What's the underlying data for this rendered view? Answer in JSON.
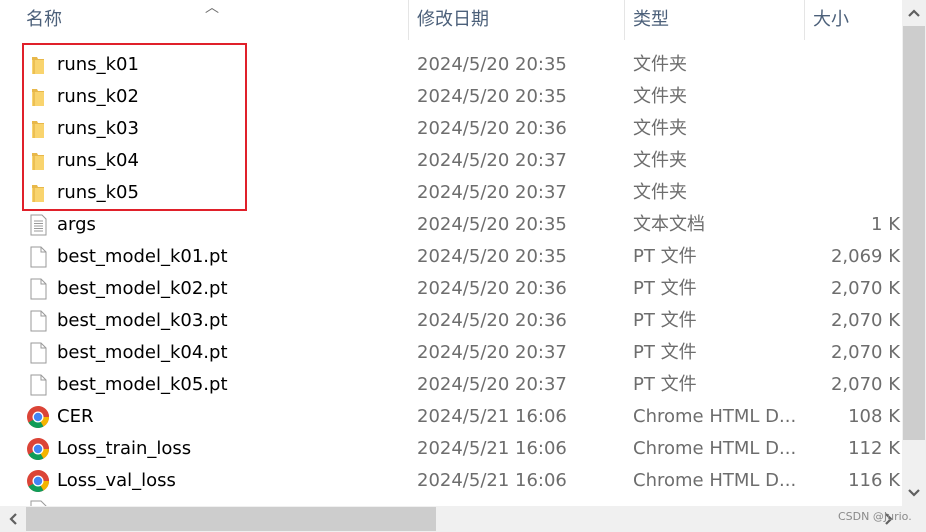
{
  "columns": {
    "name": "名称",
    "date": "修改日期",
    "type": "类型",
    "size": "大小"
  },
  "sort": {
    "column": "name",
    "direction": "ascending"
  },
  "highlight_color": "#e0202a",
  "files": [
    {
      "icon": "folder-icon",
      "name": "runs_k01",
      "date": "2024/5/20 20:35",
      "type": "文件夹",
      "size": ""
    },
    {
      "icon": "folder-icon",
      "name": "runs_k02",
      "date": "2024/5/20 20:35",
      "type": "文件夹",
      "size": ""
    },
    {
      "icon": "folder-icon",
      "name": "runs_k03",
      "date": "2024/5/20 20:36",
      "type": "文件夹",
      "size": ""
    },
    {
      "icon": "folder-icon",
      "name": "runs_k04",
      "date": "2024/5/20 20:37",
      "type": "文件夹",
      "size": ""
    },
    {
      "icon": "folder-icon",
      "name": "runs_k05",
      "date": "2024/5/20 20:37",
      "type": "文件夹",
      "size": ""
    },
    {
      "icon": "text-file-icon",
      "name": "args",
      "date": "2024/5/20 20:35",
      "type": "文本文档",
      "size": "1 K"
    },
    {
      "icon": "file-icon",
      "name": "best_model_k01.pt",
      "date": "2024/5/20 20:35",
      "type": "PT 文件",
      "size": "2,069 K"
    },
    {
      "icon": "file-icon",
      "name": "best_model_k02.pt",
      "date": "2024/5/20 20:36",
      "type": "PT 文件",
      "size": "2,070 K"
    },
    {
      "icon": "file-icon",
      "name": "best_model_k03.pt",
      "date": "2024/5/20 20:36",
      "type": "PT 文件",
      "size": "2,070 K"
    },
    {
      "icon": "file-icon",
      "name": "best_model_k04.pt",
      "date": "2024/5/20 20:37",
      "type": "PT 文件",
      "size": "2,070 K"
    },
    {
      "icon": "file-icon",
      "name": "best_model_k05.pt",
      "date": "2024/5/20 20:37",
      "type": "PT 文件",
      "size": "2,070 K"
    },
    {
      "icon": "chrome-icon",
      "name": "CER",
      "date": "2024/5/21 16:06",
      "type": "Chrome HTML D...",
      "size": "108 K"
    },
    {
      "icon": "chrome-icon",
      "name": "Loss_train_loss",
      "date": "2024/5/21 16:06",
      "type": "Chrome HTML D...",
      "size": "112 K"
    },
    {
      "icon": "chrome-icon",
      "name": "Loss_val_loss",
      "date": "2024/5/21 16:06",
      "type": "Chrome HTML D...",
      "size": "116 K"
    }
  ],
  "watermark": "CSDN @Jurio."
}
